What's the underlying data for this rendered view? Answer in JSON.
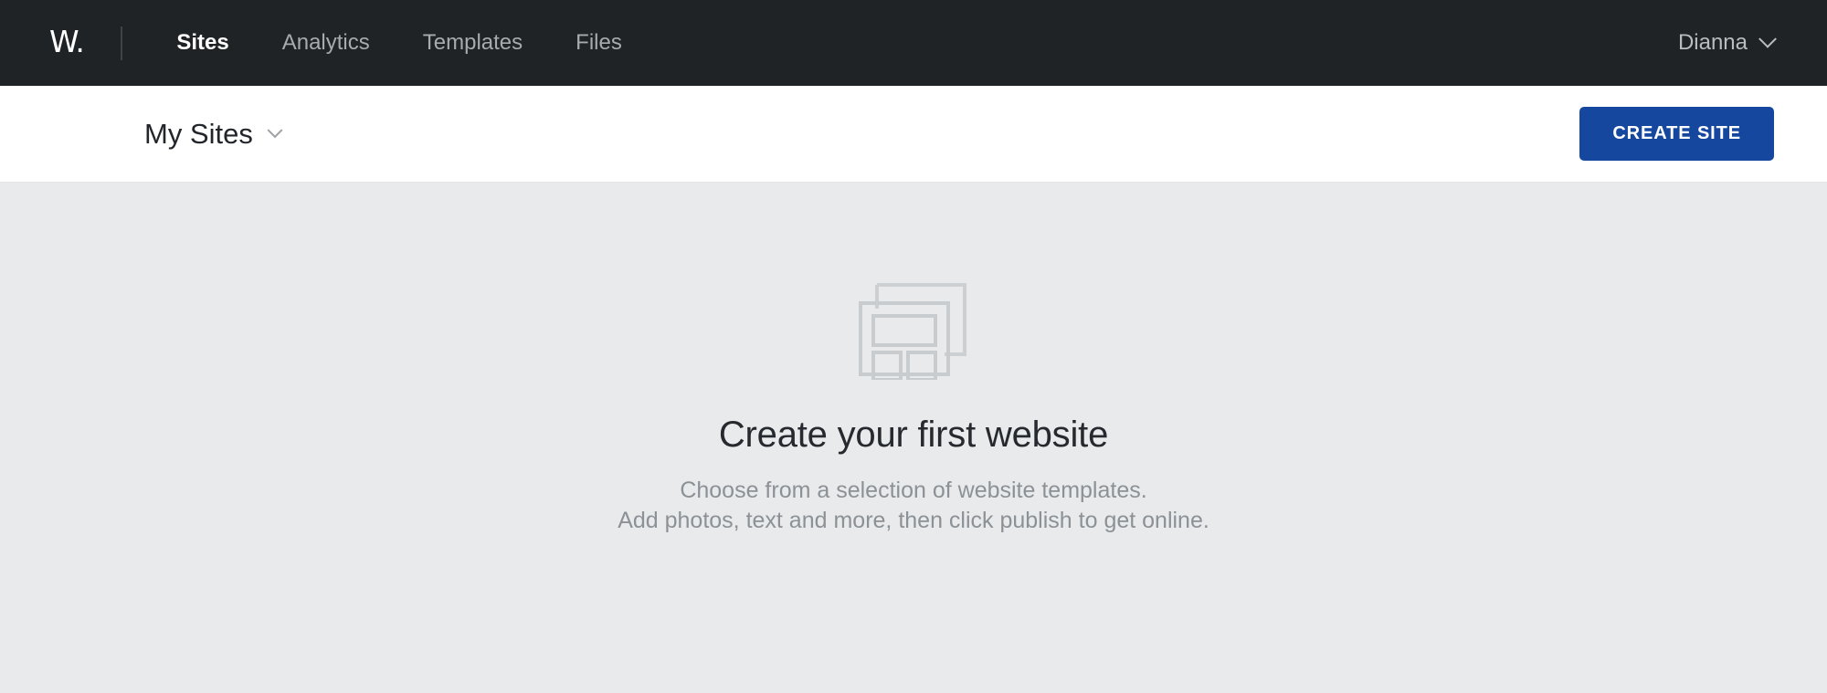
{
  "topbar": {
    "logo": "W.",
    "logo_icon": "wordpress-w-logo",
    "nav": [
      {
        "label": "Sites",
        "active": true,
        "name": "nav-item-sites"
      },
      {
        "label": "Analytics",
        "active": false,
        "name": "nav-item-analytics"
      },
      {
        "label": "Templates",
        "active": false,
        "name": "nav-item-templates"
      },
      {
        "label": "Files",
        "active": false,
        "name": "nav-item-files"
      }
    ],
    "user": {
      "name": "Dianna",
      "chevron_icon": "chevron-down-icon"
    }
  },
  "subbar": {
    "title": "My Sites",
    "title_chevron_icon": "chevron-down-icon",
    "create_button": "CREATE SITE"
  },
  "main": {
    "icon": "website-layout-icon",
    "title": "Create your first website",
    "description_line_1": "Choose from a selection of website templates.",
    "description_line_2": "Add photos, text and more, then click publish to get online."
  },
  "colors": {
    "topbar_bg": "#1f2326",
    "subbar_bg": "#ffffff",
    "content_bg": "#e8eaec",
    "accent_blue": "#16479e",
    "nav_inactive": "#a7abae",
    "nav_active": "#ffffff",
    "muted_text": "#8c9196",
    "icon_stroke": "#c9cccf"
  }
}
